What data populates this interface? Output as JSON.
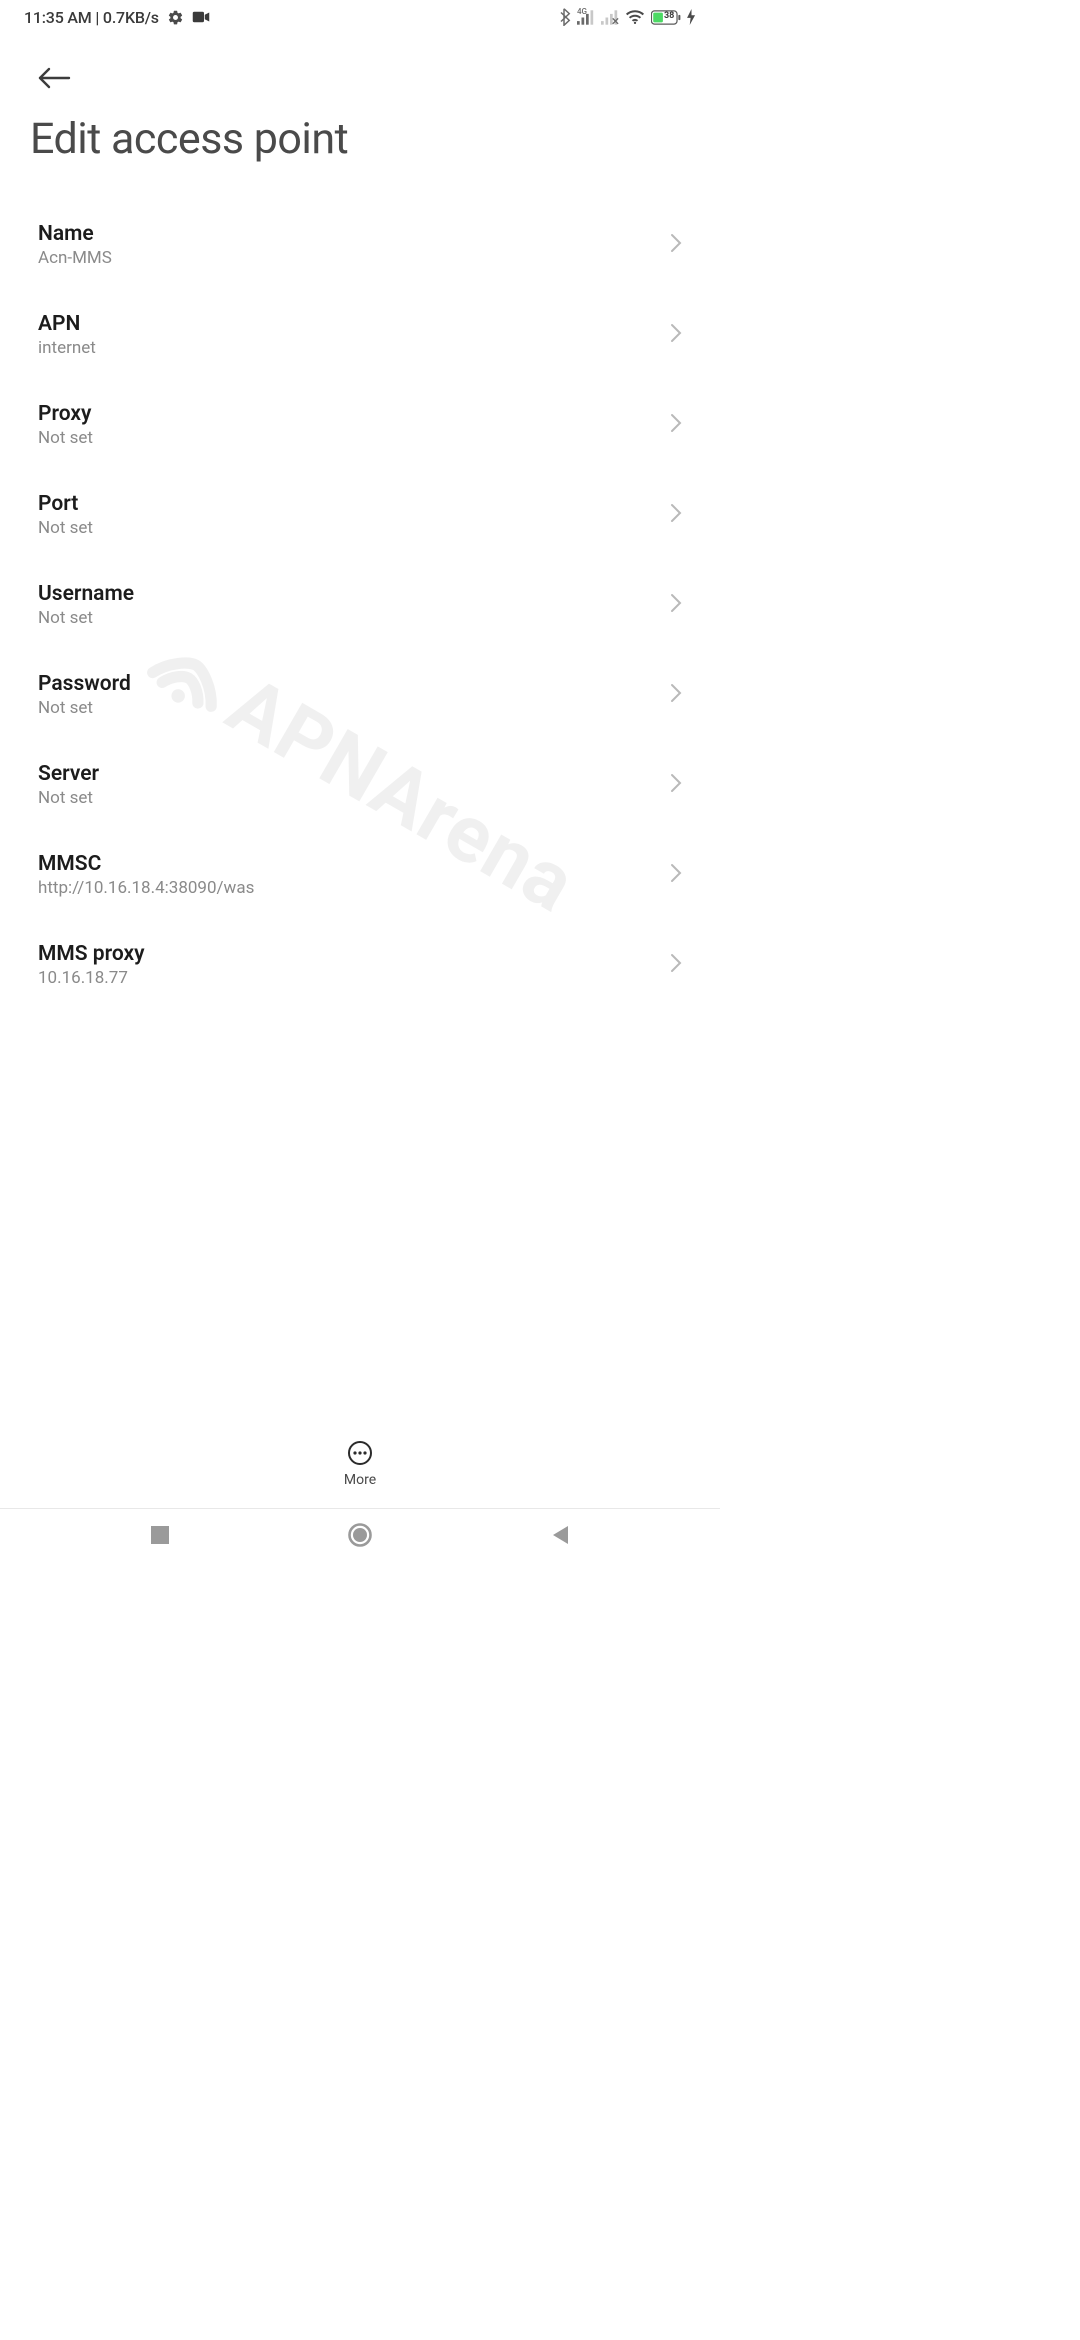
{
  "status_bar": {
    "time": "11:35 AM",
    "speed": "0.7KB/s",
    "network_label": "4G",
    "battery_pct": "38"
  },
  "header": {
    "title": "Edit access point"
  },
  "settings": {
    "items": [
      {
        "label": "Name",
        "value": "Acn-MMS"
      },
      {
        "label": "APN",
        "value": "internet"
      },
      {
        "label": "Proxy",
        "value": "Not set"
      },
      {
        "label": "Port",
        "value": "Not set"
      },
      {
        "label": "Username",
        "value": "Not set"
      },
      {
        "label": "Password",
        "value": "Not set"
      },
      {
        "label": "Server",
        "value": "Not set"
      },
      {
        "label": "MMSC",
        "value": "http://10.16.18.4:38090/was"
      },
      {
        "label": "MMS proxy",
        "value": "10.16.18.77"
      }
    ]
  },
  "actions": {
    "more_label": "More"
  },
  "watermark": {
    "text": "APNArena"
  }
}
